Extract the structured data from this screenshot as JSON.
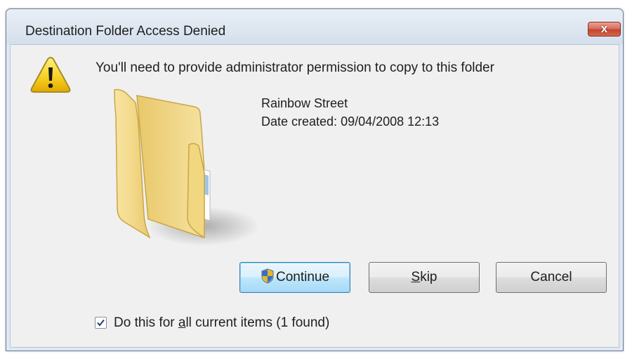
{
  "window": {
    "title": "Destination Folder Access Denied",
    "close_glyph": "x"
  },
  "dialog": {
    "message": "You'll need to provide administrator permission to copy to this folder",
    "icon": "warning-icon",
    "item": {
      "icon": "folder-icon",
      "name": "Rainbow Street",
      "date_created": "Date created: 09/04/2008 12:13"
    }
  },
  "buttons": {
    "continue": {
      "label": "Continue",
      "icon": "uac-shield-icon",
      "is_default": true
    },
    "skip": {
      "pre": "",
      "accel": "S",
      "post": "kip"
    },
    "cancel": {
      "label": "Cancel"
    }
  },
  "apply_all": {
    "checked": true,
    "pre": "Do this for ",
    "accel": "a",
    "post": "ll current items (1 found)"
  },
  "colors": {
    "window_frame": "#dfe8f3",
    "client_bg": "#f0f0f0",
    "close_button": "#c54330",
    "default_button_border": "#3c7fb1"
  }
}
